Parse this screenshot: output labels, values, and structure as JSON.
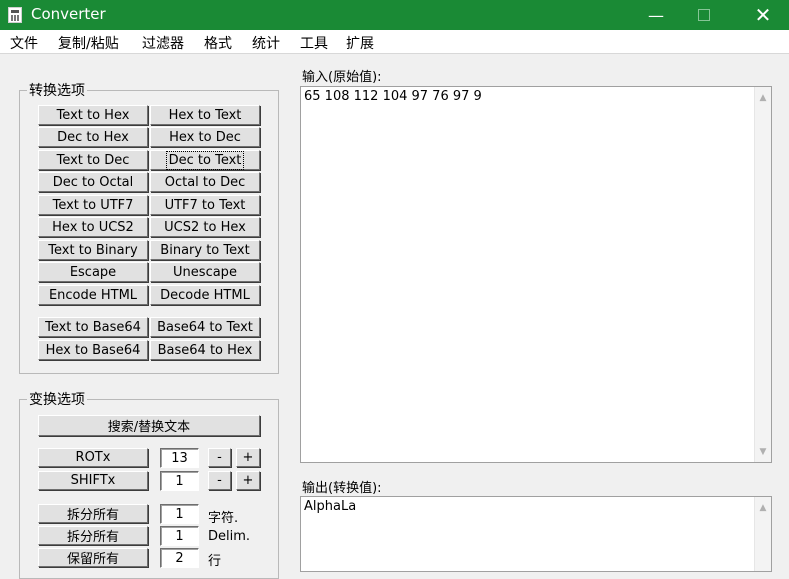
{
  "window": {
    "title": "Converter",
    "minimize_glyph": "—",
    "close_glyph": "✕"
  },
  "menu": [
    "文件",
    "复制/粘贴",
    "过滤器",
    "格式",
    "统计",
    "工具",
    "扩展"
  ],
  "conversion": {
    "title": "转换选项",
    "buttons": [
      [
        "Text to Hex",
        "Hex to Text"
      ],
      [
        "Dec to Hex",
        "Hex to Dec"
      ],
      [
        "Text to Dec",
        "Dec to Text"
      ],
      [
        "Dec to Octal",
        "Octal to Dec"
      ],
      [
        "Text to UTF7",
        "UTF7 to Text"
      ],
      [
        "Hex to UCS2",
        "UCS2 to Hex"
      ],
      [
        "Text to Binary",
        "Binary to Text"
      ],
      [
        "Escape",
        "Unescape"
      ],
      [
        "Encode HTML",
        "Decode HTML"
      ],
      [
        "Text to Base64",
        "Base64 to Text"
      ],
      [
        "Hex to Base64",
        "Base64 to Hex"
      ]
    ]
  },
  "transform": {
    "title": "变换选项",
    "search_replace": "搜索/替换文本",
    "rot_label": "ROTx",
    "rot_value": "13",
    "shift_label": "SHIFTx",
    "shift_value": "1",
    "minus": "-",
    "plus": "+",
    "split_all_1": "拆分所有",
    "split_value_1": "1",
    "split_unit_1": "字符.",
    "split_all_2": "拆分所有",
    "split_value_2": "1",
    "split_unit_2": "Delim.",
    "keep_all": "保留所有",
    "keep_value": "2",
    "keep_unit": "行"
  },
  "input": {
    "label": "输入(原始值):",
    "value": "65 108 112 104 97 76 97 9"
  },
  "output": {
    "label": "输出(转换值):",
    "value": "AlphaLa"
  },
  "colors": {
    "titlebar": "#1a8a35",
    "window_bg": "#f0f0f0"
  }
}
